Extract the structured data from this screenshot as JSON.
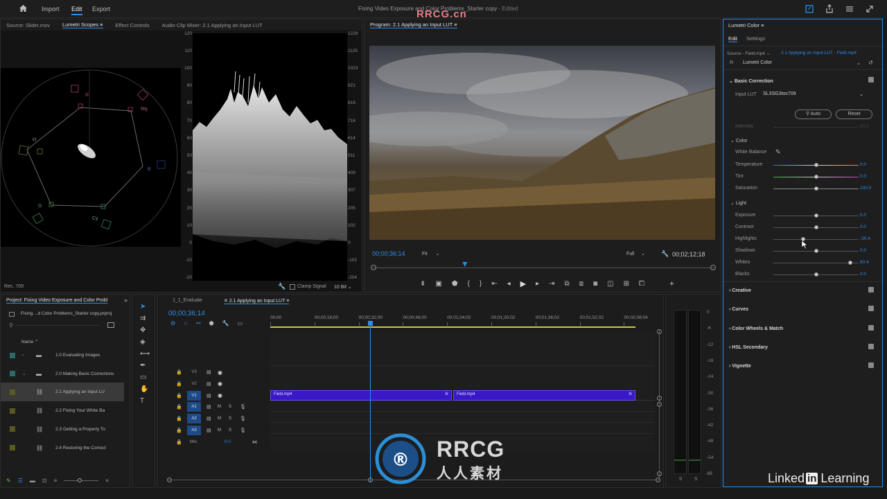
{
  "app": {
    "title": "Fixing Video Exposure and Color Problems_Starter copy",
    "edited": "- Edited",
    "menu": [
      "Import",
      "Edit",
      "Export"
    ],
    "active_menu": "Edit"
  },
  "watermark": {
    "top": "RRCG.cn",
    "logo_main": "RRCG",
    "logo_sub": "人人素材",
    "brand_a": "Linked",
    "brand_in": "in",
    "brand_b": "Learning"
  },
  "source_panel": {
    "tabs": [
      "Source: Slider.mov",
      "Lumetri Scopes",
      "Effect Controls",
      "Audio Clip Mixer: 2.1 Applying an Input LUT"
    ],
    "active_tab": "Lumetri Scopes",
    "vectorscope_labels": [
      "R",
      "Mg",
      "B",
      "Cy",
      "G",
      "Yl"
    ],
    "waveform_left_scale": [
      "120",
      "110",
      "100",
      "90",
      "80",
      "70",
      "60",
      "50",
      "40",
      "30",
      "20",
      "10",
      "0",
      "-10",
      "-20"
    ],
    "waveform_right_scale": [
      "1228",
      "1125",
      "1023",
      "921",
      "818",
      "716",
      "614",
      "511",
      "409",
      "307",
      "205",
      "102",
      "0",
      "-102",
      "-204"
    ],
    "rec": "Rec. 709",
    "clamp_signal": "Clamp Signal",
    "bit_depth": "10 Bit"
  },
  "program_monitor": {
    "title": "Program: 2.1 Applying an Input LUT",
    "timecode_current": "00;00;36;14",
    "fit": "Fit",
    "quality": "Full",
    "timecode_duration": "00;02;12;18",
    "playhead_fraction": 0.27
  },
  "lumetri": {
    "panel_title": "Lumetri Color",
    "tabs": [
      "Edit",
      "Settings"
    ],
    "source_left": "Source - Field.mp4",
    "source_right": "2.1 Applying an Input LUT - Field.mp4",
    "effect_name": "Lumetri Color",
    "basic_correction": "Basic Correction",
    "input_lut_label": "Input LUT",
    "input_lut_value": "SL3SG3tos709",
    "auto_label": "Auto",
    "reset_label": "Reset",
    "intensity_label": "Intensity",
    "intensity_value": "50.0",
    "color_head": "Color",
    "white_balance": "White Balance",
    "light_head": "Light",
    "sliders": [
      {
        "label": "Temperature",
        "value": "0.0",
        "pos": 0.5
      },
      {
        "label": "Tint",
        "value": "0.0",
        "pos": 0.5
      },
      {
        "label": "Saturation",
        "value": "100.0",
        "pos": 0.5
      },
      {
        "label": "Exposure",
        "value": "0.0",
        "pos": 0.5
      },
      {
        "label": "Contrast",
        "value": "0.0",
        "pos": 0.5
      },
      {
        "label": "Highlights",
        "value": "-30.4",
        "pos": 0.35
      },
      {
        "label": "Shadows",
        "value": "0.0",
        "pos": 0.5
      },
      {
        "label": "Whites",
        "value": "80.4",
        "pos": 0.9
      },
      {
        "label": "Blacks",
        "value": "0.0",
        "pos": 0.5
      }
    ],
    "sections": [
      "Creative",
      "Curves",
      "Color Wheels & Match",
      "HSL Secondary",
      "Vignette"
    ]
  },
  "project": {
    "title": "Project: Fixing Video Exposure and Color Probl",
    "file": "Fixing ...d Color Problems_Starter copy.prproj",
    "name_col": "Name",
    "items": [
      {
        "label": "1.0 Evaluating Images",
        "type": "folder"
      },
      {
        "label": "2.0 Making Basic Corrections",
        "type": "folder"
      },
      {
        "label": "2.1 Applying an Input LU",
        "type": "sequence"
      },
      {
        "label": "2.2 Fixing Your White Ba",
        "type": "sequence"
      },
      {
        "label": "2.3 Getting a Properly To",
        "type": "sequence"
      },
      {
        "label": "2.4 Restoring the Correct",
        "type": "sequence"
      }
    ]
  },
  "timeline": {
    "tabs": [
      "1_1_Evaluate",
      "2.1 Applying an Input LUT"
    ],
    "active_tab": "2.1 Applying an Input LUT",
    "timecode": "00;00;36;14",
    "ruler": [
      "00;00",
      "00;00;16;00",
      "00;00;32;00",
      "00;00;48;00",
      "00;01;04;02",
      "00;01;20;02",
      "00;01;36;02",
      "00;01;52;02",
      "00;02;08;04"
    ],
    "video_tracks": [
      "V3",
      "V2",
      "V1"
    ],
    "audio_tracks": [
      "A1",
      "A2",
      "A3"
    ],
    "mix_label": "Mix",
    "mix_value": "0.0",
    "clips": [
      {
        "label": "Field.mp4"
      },
      {
        "label": "Field.mp4"
      }
    ],
    "fx": "fx"
  },
  "audio_meter": {
    "scale": [
      "0",
      "-6",
      "-12",
      "-18",
      "-24",
      "-30",
      "-36",
      "-42",
      "-48",
      "-54",
      "dB"
    ],
    "channels": [
      "S",
      "S"
    ]
  }
}
